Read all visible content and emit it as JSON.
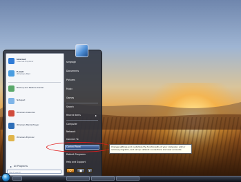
{
  "left_programs": [
    {
      "label": "Internet",
      "sublabel": "Internet Explorer",
      "icon": "internet-explorer-icon",
      "color": "#2f7bd6"
    },
    {
      "label": "E-mail",
      "sublabel": "Windows Mail",
      "icon": "mail-icon",
      "color": "#4a9de0"
    },
    {
      "label": "Backup and Restore Center",
      "sublabel": "",
      "icon": "backup-icon",
      "color": "#5aa86a"
    },
    {
      "label": "Notepad",
      "sublabel": "",
      "icon": "notepad-icon",
      "color": "#7fb5e8"
    },
    {
      "label": "Windows Calendar",
      "sublabel": "",
      "icon": "calendar-icon",
      "color": "#d04b3b"
    },
    {
      "label": "Windows Media Player",
      "sublabel": "",
      "icon": "media-player-icon",
      "color": "#2f6fb8"
    },
    {
      "label": "Windows Explorer",
      "sublabel": "",
      "icon": "folder-icon",
      "color": "#e0b44a"
    }
  ],
  "all_programs_label": "All Programs",
  "search_placeholder": "Start Search",
  "right_items": [
    "sergrogh",
    "Documents",
    "Pictures",
    "Music",
    "Games",
    "Search",
    "Recent Items",
    "Computer",
    "Network",
    "Connect To",
    "Control Panel",
    "Default Programs",
    "Help and Support"
  ],
  "tooltip": "Change settings and customize the functionality of your computer, add or remove programs, and set up network connections and user accounts.",
  "colors": {
    "highlight": "#2e4f86",
    "annotation": "#e21b1b"
  }
}
